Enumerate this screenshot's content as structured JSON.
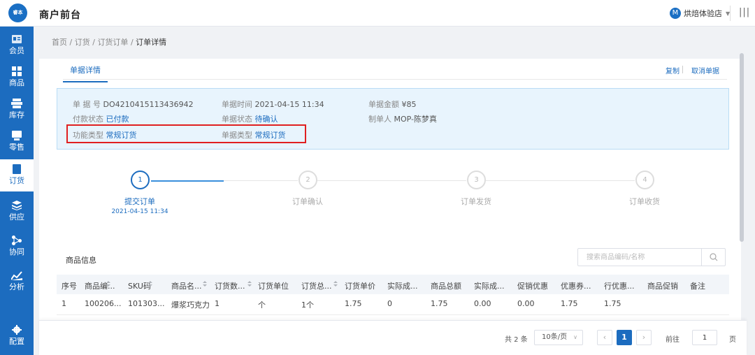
{
  "header": {
    "logo_text": "睿本",
    "title": "商户前台",
    "store_initial": "M",
    "store_name": "烘焙体验店"
  },
  "sidebar": {
    "items": [
      {
        "label": "会员",
        "icon": "member-icon"
      },
      {
        "label": "商品",
        "icon": "grid-icon"
      },
      {
        "label": "库存",
        "icon": "inventory-icon"
      },
      {
        "label": "零售",
        "icon": "retail-icon"
      },
      {
        "label": "订货",
        "icon": "order-icon",
        "active": true
      },
      {
        "label": "供应",
        "icon": "supply-icon"
      },
      {
        "label": "协同",
        "icon": "collaborate-icon"
      },
      {
        "label": "分析",
        "icon": "chart-icon"
      },
      {
        "label": "配置",
        "icon": "gear-icon"
      }
    ]
  },
  "breadcrumb": {
    "items": [
      "首页",
      "订货",
      "订货订单"
    ],
    "separator": "/",
    "current": "订单详情"
  },
  "tabs": {
    "active": "单据详情"
  },
  "actions": {
    "copy": "复制",
    "cancel": "取消单据"
  },
  "info": {
    "doc_no_label": "单 据 号",
    "doc_no": "DO4210415113436942",
    "doc_time_label": "单据时间",
    "doc_time": "2021-04-15 11:34",
    "amount_label": "单据金额",
    "amount": "¥85",
    "pay_status_label": "付款状态",
    "pay_status": "已付款",
    "doc_status_label": "单据状态",
    "doc_status": "待确认",
    "creator_label": "制单人",
    "creator": "MOP-陈梦真",
    "func_type_label": "功能类型",
    "func_type": "常规订货",
    "doc_type_label": "单据类型",
    "doc_type": "常规订货"
  },
  "steps": [
    {
      "num": "1",
      "label": "提交订单",
      "time": "2021-04-15 11:34",
      "done": true
    },
    {
      "num": "2",
      "label": "订单确认"
    },
    {
      "num": "3",
      "label": "订单发货"
    },
    {
      "num": "4",
      "label": "订单收货"
    }
  ],
  "products": {
    "title": "商品信息",
    "search_placeholder": "搜索商品编码/名称",
    "columns": [
      "序号",
      "商品编...",
      "SKU码",
      "商品名...",
      "订货数...",
      "订货单位",
      "订货总...",
      "订货单价",
      "实际成...",
      "商品总额",
      "实际成...",
      "促销优惠",
      "优惠券...",
      "行优惠...",
      "商品促销",
      "备注"
    ],
    "rows": [
      [
        "1",
        "100206...",
        "101303...",
        "爆浆巧克力",
        "1",
        "个",
        "1个",
        "1.75",
        "0",
        "1.75",
        "0.00",
        "0.00",
        "1.75",
        "1.75",
        "",
        ""
      ]
    ]
  },
  "pagination": {
    "total": "共 2 条",
    "page_size": "10条/页",
    "current_page": "1",
    "goto_label": "前往",
    "goto_value": "1",
    "page_suffix": "页"
  },
  "colors": {
    "primary": "#1c6cbf",
    "highlight_border": "#e02020",
    "info_bg": "#e8f4fd"
  }
}
